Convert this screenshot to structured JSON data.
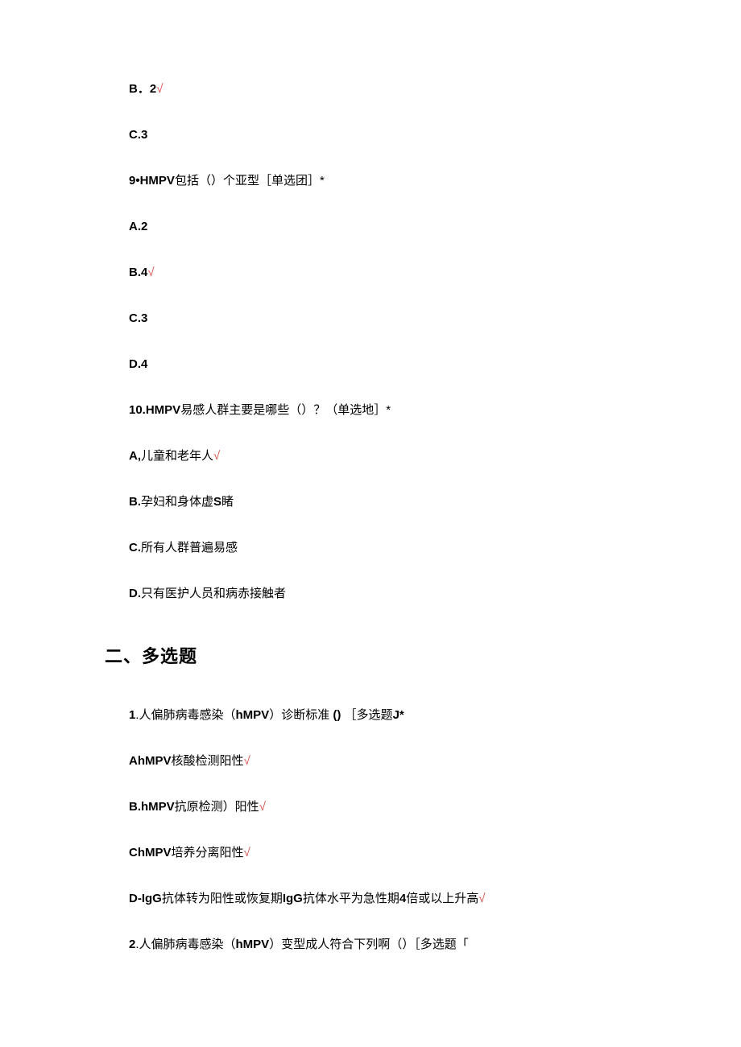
{
  "lines": [
    {
      "prefix": "B．",
      "body": "2",
      "mark": "√",
      "prefixBold": true,
      "bodyBold": true
    },
    {
      "prefix": "C.3",
      "body": "",
      "mark": "",
      "prefixBold": true
    },
    {
      "prefix": "9•HMPV",
      "body": "包括（）个亚型［单选团］*",
      "mark": "",
      "prefixBold": true
    },
    {
      "prefix": "A.2",
      "body": "",
      "mark": "",
      "prefixBold": true
    },
    {
      "prefix": "B.4",
      "body": "",
      "mark": "√",
      "prefixBold": true
    },
    {
      "prefix": "C.3",
      "body": "",
      "mark": "",
      "prefixBold": true
    },
    {
      "prefix": "D.4",
      "body": "",
      "mark": "",
      "prefixBold": true
    },
    {
      "prefix": "10.HMPV",
      "body": "易感人群主要是哪些（）？（单选地］*",
      "mark": "",
      "prefixBold": true
    },
    {
      "prefix": "A,",
      "body": "儿童和老年人",
      "mark": "√",
      "prefixBold": true
    },
    {
      "prefix": "B.",
      "body2": "孕妇和身体虚",
      "suffix": "S",
      "body3": "睹",
      "mark": "",
      "prefixBold": true,
      "suffixBold": true
    },
    {
      "prefix": "C.",
      "body": "所有人群普遍易感",
      "mark": "",
      "prefixBold": true
    },
    {
      "prefix": "D.",
      "body": "只有医护人员和病赤接触者",
      "mark": "",
      "prefixBold": true
    }
  ],
  "section_heading": "二、多选题",
  "lines2": [
    {
      "prefix": "1",
      "body2": ".人偏肺病毒感染（",
      "mid": "hMPV",
      "body3": "）诊断标准",
      "paren": "()",
      "tail": "［多选题",
      "jstar": "J*",
      "prefixBold": true,
      "midBold": true,
      "parenBold": true,
      "jstarBold": true
    },
    {
      "prefix": "AhMPV",
      "body": "核酸检测阳性",
      "mark": "√",
      "prefixBold": true
    },
    {
      "prefix": "B.hMPV",
      "body": "抗原检测）阳性",
      "mark": "√",
      "prefixBold": true
    },
    {
      "prefix": "ChMPV",
      "body": "培养分离阳性",
      "mark": "√",
      "prefixBold": true
    },
    {
      "prefix": "D-IgG",
      "body2": "抗体转为阳性或恢复期",
      "mid": "IgG",
      "body3": "抗体水平为急性期",
      "num": "4",
      "tail": "倍或以上升高",
      "mark": "√",
      "prefixBold": true,
      "midBold": true,
      "numBold": true
    },
    {
      "prefix": "2",
      "body2": ".人偏肺病毒感染（",
      "mid": "hMPV",
      "body3": "）变型成人符合下列啊（）［多选题「",
      "prefixBold": true,
      "midBold": true
    }
  ]
}
